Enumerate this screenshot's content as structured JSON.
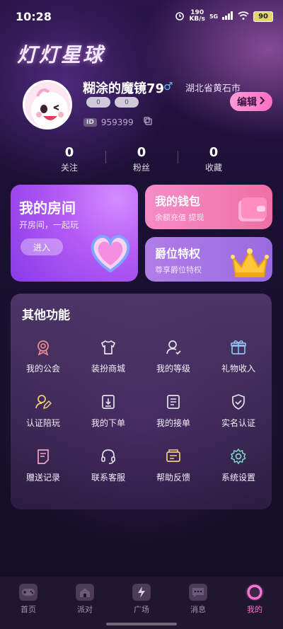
{
  "status_bar": {
    "time": "10:28",
    "speed_value": "190",
    "speed_unit": "KB/s",
    "network": "5G",
    "battery": "90"
  },
  "app": {
    "title": "灯灯星球"
  },
  "profile": {
    "name": "糊涂的魔镜79",
    "gender_symbol": "♂",
    "location": "湖北省黄石市",
    "badges": [
      "0",
      "0"
    ],
    "id_label": "ID",
    "id_value": "959399",
    "edit_label": "编辑"
  },
  "stats": [
    {
      "value": "0",
      "label": "关注"
    },
    {
      "value": "0",
      "label": "粉丝"
    },
    {
      "value": "0",
      "label": "收藏"
    }
  ],
  "room": {
    "title": "我的房间",
    "subtitle": "开房间，一起玩",
    "enter_label": "进入"
  },
  "wallet": {
    "title": "我的钱包",
    "subtitle": "余额充值 提现"
  },
  "vip": {
    "title": "爵位特权",
    "subtitle": "尊享爵位特权"
  },
  "other": {
    "title": "其他功能",
    "items": [
      {
        "label": "我的公会",
        "icon": "medal-icon"
      },
      {
        "label": "装扮商城",
        "icon": "shirt-icon"
      },
      {
        "label": "我的等级",
        "icon": "user-level-icon"
      },
      {
        "label": "礼物收入",
        "icon": "gift-icon"
      },
      {
        "label": "认证陪玩",
        "icon": "user-verify-icon"
      },
      {
        "label": "我的下单",
        "icon": "order-icon"
      },
      {
        "label": "我的接单",
        "icon": "list-icon"
      },
      {
        "label": "实名认证",
        "icon": "shield-check-icon"
      },
      {
        "label": "赠送记录",
        "icon": "record-icon"
      },
      {
        "label": "联系客服",
        "icon": "headset-icon"
      },
      {
        "label": "帮助反馈",
        "icon": "feedback-icon"
      },
      {
        "label": "系统设置",
        "icon": "gear-icon"
      }
    ]
  },
  "tabs": [
    {
      "label": "首页",
      "icon": "gamepad-icon"
    },
    {
      "label": "派对",
      "icon": "house-icon"
    },
    {
      "label": "广场",
      "icon": "lightning-icon"
    },
    {
      "label": "消息",
      "icon": "chat-icon"
    },
    {
      "label": "我的",
      "icon": "planet-icon",
      "active": true
    }
  ],
  "colors": {
    "accent": "#ff6fd0",
    "room_card": "#a64cf0",
    "wallet_card": "#f07aae",
    "vip_card": "#a574e4"
  }
}
